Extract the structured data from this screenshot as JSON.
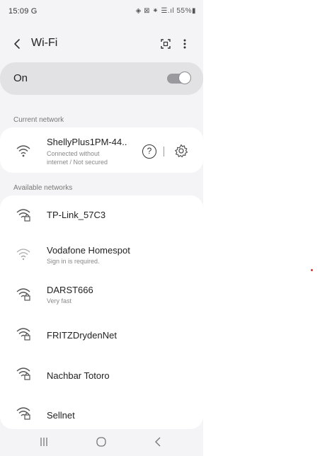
{
  "status_bar": {
    "time": "15:09 G",
    "icons": "◈ ⊠ ⁕ ☰.ıl 55%▮"
  },
  "header": {
    "title": "Wi-Fi"
  },
  "wifi_toggle": {
    "label": "On",
    "state": "on"
  },
  "current_network": {
    "section_label": "Current network",
    "name": "ShellyPlus1PM-44..",
    "status_line1": "Connected without",
    "status_line2": "internet / Not secured",
    "help_label": "?"
  },
  "available": {
    "section_label": "Available networks",
    "networks": [
      {
        "name": "TP-Link_57C3",
        "sub": "",
        "locked": true
      },
      {
        "name": "Vodafone Homespot",
        "sub": "Sign in is required.",
        "locked": false
      },
      {
        "name": "DARST666",
        "sub": "Very fast",
        "locked": true
      },
      {
        "name": "FRITZDrydenNet",
        "sub": "",
        "locked": true
      },
      {
        "name": "Nachbar Totoro",
        "sub": "",
        "locked": true
      },
      {
        "name": "Sellnet",
        "sub": "",
        "locked": true
      }
    ]
  },
  "colors": {
    "background": "#f4f4f6",
    "card": "#ffffff",
    "toggle_row": "#e2e2e4",
    "marker": "#e0302a"
  }
}
